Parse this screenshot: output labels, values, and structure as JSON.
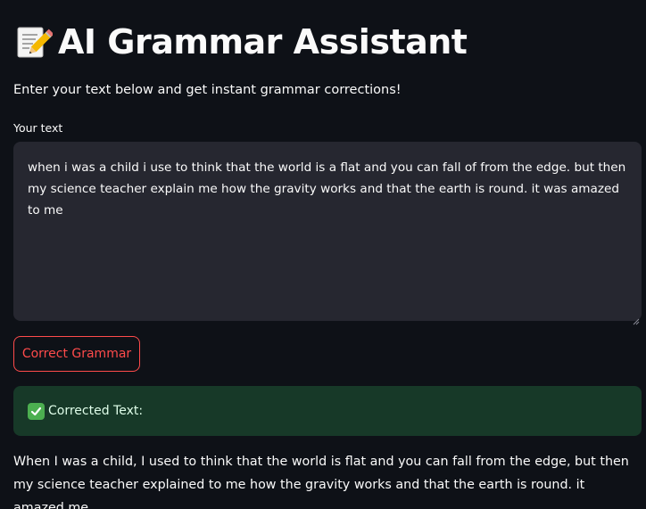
{
  "header": {
    "icon": "memo-icon",
    "title": "AI Grammar Assistant"
  },
  "subtitle": "Enter your text below and get instant grammar corrections!",
  "input": {
    "label": "Your text",
    "value": "when i was a child i use to think that the world is a flat and you can fall of from the edge. but then my science teacher explain me how the gravity works and that the earth is round. it was amazed to me"
  },
  "button": {
    "label": "Correct Grammar"
  },
  "success": {
    "icon": "check-mark-icon",
    "label": "Corrected Text:"
  },
  "result": {
    "text": "When I was a child, I used to think that the world is flat and you can fall from the edge, but then my science teacher explained to me how the gravity works and that the earth is round. it amazed me."
  },
  "colors": {
    "background": "#0e1117",
    "input_background": "#262730",
    "accent": "#ff4b4b",
    "success_background": "#173928"
  }
}
